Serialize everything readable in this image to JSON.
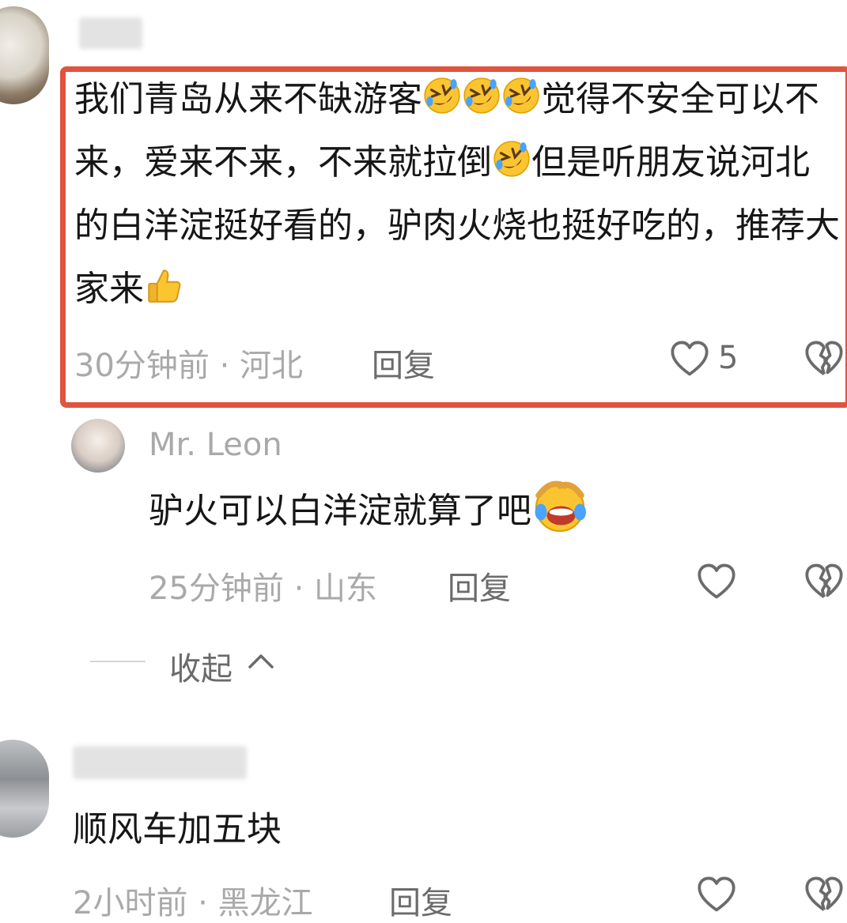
{
  "comments": [
    {
      "text_parts": [
        "我们青岛从来不缺游客",
        "",
        "",
        "",
        "觉得不安全可以不来，爱来不来，不来就拉倒",
        "",
        "但是听朋友说河北的白洋淀挺好看的，驴肉火烧也挺好吃的，推荐大家来",
        ""
      ],
      "time_location": "30分钟前 · 河北",
      "reply_label": "回复",
      "like_count": "5",
      "highlight_color": "#e0533d"
    },
    {
      "username": "Mr. Leon",
      "text": "驴火可以白洋淀就算了吧",
      "time_location": "25分钟前 · 山东",
      "reply_label": "回复"
    },
    {
      "text": "顺风车加五块",
      "time_location": "2小时前 · 黑龙江",
      "reply_label": "回复"
    }
  ],
  "collapse_label": "收起",
  "icons": {
    "rofl": "rofl-emoji",
    "screaming": "laughing-crying-emoji",
    "thumbs_up": "thumbs-up-emoji",
    "like": "heart-outline-icon",
    "dislike": "broken-heart-icon",
    "collapse": "chevron-up-icon"
  },
  "colors": {
    "highlight": "#e0533d",
    "meta": "#a9a9a9",
    "text": "#161616"
  }
}
